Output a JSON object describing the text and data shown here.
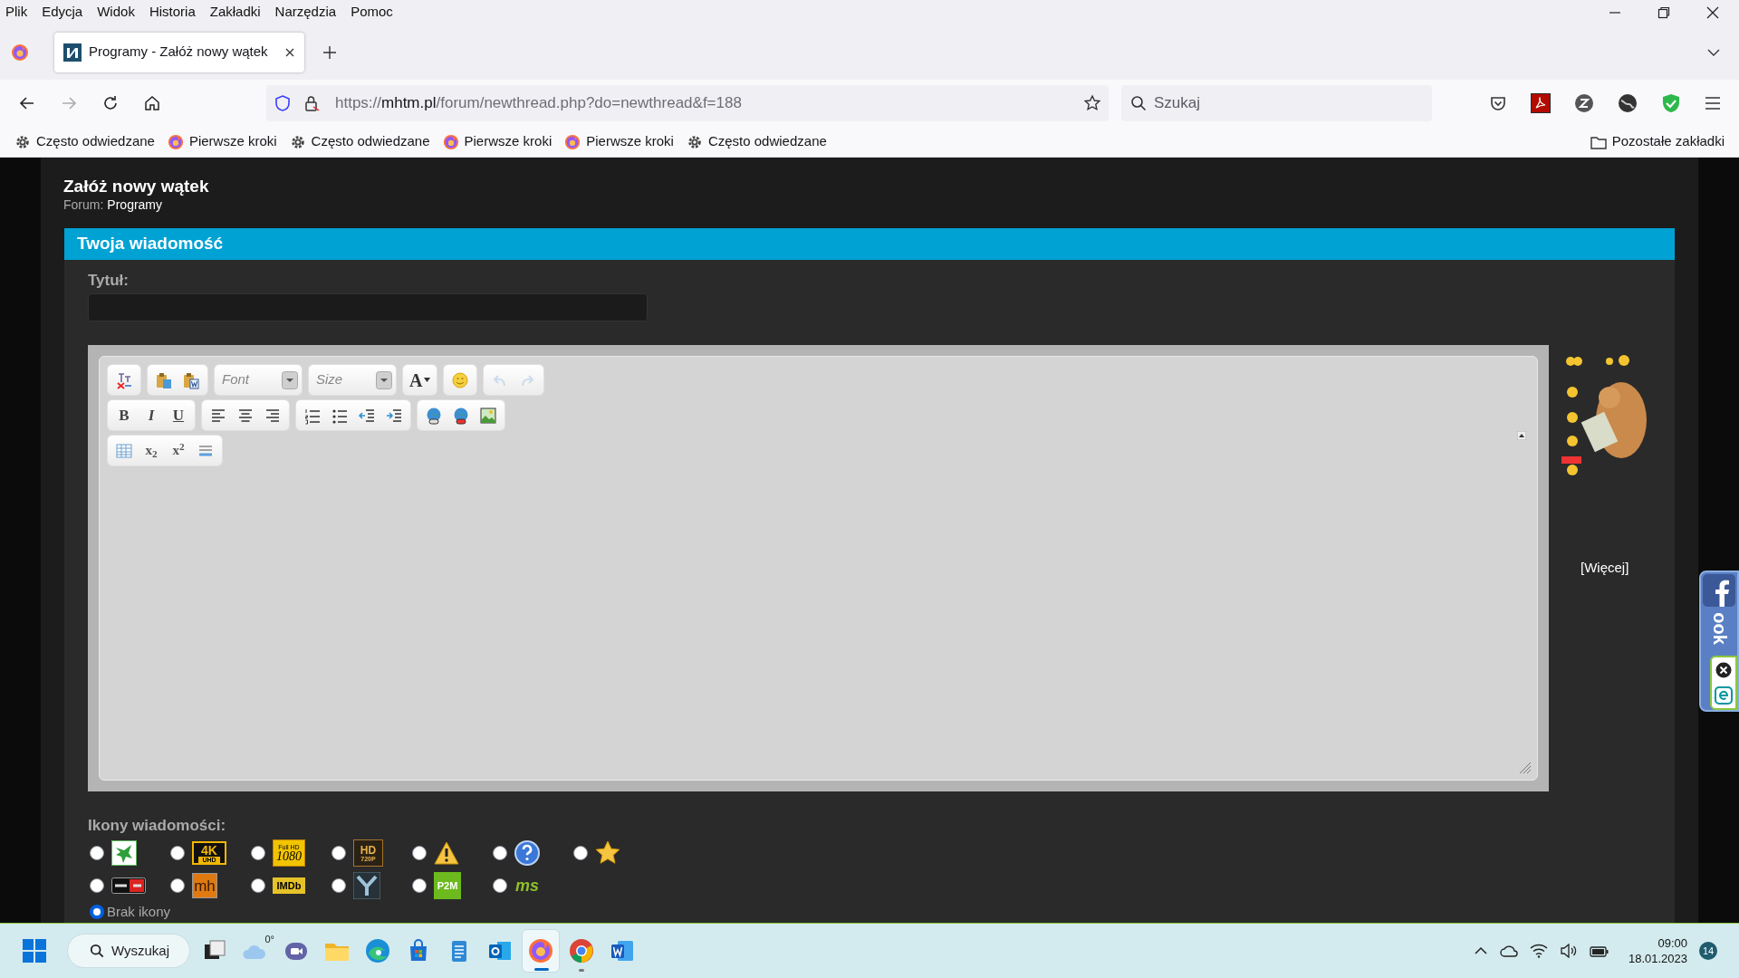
{
  "menu": [
    "Plik",
    "Edycja",
    "Widok",
    "Historia",
    "Zakładki",
    "Narzędzia",
    "Pomoc"
  ],
  "tab": {
    "title": "Programy - Załóż nowy wątek",
    "selected": true
  },
  "address_bar": {
    "url_scheme": "https://",
    "url_host": "mhtm.pl",
    "url_path": "/forum/newthread.php?do=newthread&f=188"
  },
  "search_field": {
    "placeholder": "Szukaj"
  },
  "bookmarks": [
    {
      "kind": "gear",
      "label": "Często odwiedzane"
    },
    {
      "kind": "firefox",
      "label": "Pierwsze kroki"
    },
    {
      "kind": "gear",
      "label": "Często odwiedzane"
    },
    {
      "kind": "firefox",
      "label": "Pierwsze kroki"
    },
    {
      "kind": "firefox",
      "label": "Pierwsze kroki"
    },
    {
      "kind": "gear",
      "label": "Często odwiedzane"
    }
  ],
  "other_bookmarks": "Pozostałe zakładki",
  "page": {
    "title": "Załóż nowy wątek",
    "forum_label": "Forum:",
    "forum_link": "Programy",
    "section_title": "Twoja wiadomość",
    "title_field": {
      "label": "Tytuł:"
    },
    "editor": {
      "toolbar": [
        [
          [
            {
              "kind": "remove-format",
              "disabled": false
            }
          ],
          [
            {
              "kind": "paste",
              "disabled": false
            },
            {
              "kind": "paste-word",
              "disabled": false
            }
          ],
          [
            {
              "kind": "select",
              "placeholder": "Font",
              "disabled": false
            }
          ],
          [
            {
              "kind": "select",
              "placeholder": "Size",
              "disabled": false
            }
          ],
          [
            {
              "kind": "font-color",
              "label": "A",
              "disabled": false
            }
          ],
          [
            {
              "kind": "smiley",
              "disabled": false
            }
          ],
          [
            {
              "kind": "undo",
              "disabled": true
            },
            {
              "kind": "redo",
              "disabled": true
            }
          ]
        ],
        [
          [
            {
              "kind": "bold",
              "label": "B",
              "disabled": false
            },
            {
              "kind": "italic",
              "label": "I",
              "disabled": false
            },
            {
              "kind": "underline",
              "label": "U",
              "disabled": false
            }
          ],
          [
            {
              "kind": "align-left",
              "disabled": false
            },
            {
              "kind": "align-center",
              "disabled": false
            },
            {
              "kind": "align-right",
              "disabled": false
            }
          ],
          [
            {
              "kind": "ordered-list",
              "disabled": false
            },
            {
              "kind": "bullet-list",
              "disabled": false
            },
            {
              "kind": "outdent",
              "disabled": false
            },
            {
              "kind": "indent",
              "disabled": false
            }
          ],
          [
            {
              "kind": "link",
              "disabled": false
            },
            {
              "kind": "unlink",
              "disabled": false
            },
            {
              "kind": "image",
              "disabled": false
            }
          ]
        ],
        [
          [
            {
              "kind": "table",
              "disabled": false
            },
            {
              "kind": "subscript",
              "label": "x$_{2}$",
              "disabled": false
            },
            {
              "kind": "superscript",
              "label": "x$^{2}$",
              "disabled": false
            },
            {
              "kind": "horizontal-rule",
              "disabled": false
            }
          ]
        ]
      ]
    },
    "smilies_more": "[Więcej]",
    "message_icons": {
      "label": "Ikony wiadomości:",
      "rows": [
        [
          {
            "kind": "leaf",
            "selected": false
          },
          {
            "kind": "uhd",
            "lines": [
              "4K",
              "UHD"
            ],
            "selected": false
          },
          {
            "kind": "fullhd",
            "lines": [
              "Full HD",
              "1080"
            ],
            "selected": false
          },
          {
            "kind": "hd",
            "lines": [
              "HD",
              "720P"
            ],
            "selected": false
          },
          {
            "kind": "warning",
            "selected": false
          },
          {
            "kind": "question",
            "selected": false
          },
          {
            "kind": "star",
            "selected": false
          }
        ],
        [
          {
            "kind": "banner",
            "selected": false
          },
          {
            "kind": "mh",
            "lines": [
              "mh"
            ],
            "selected": false
          },
          {
            "kind": "imdb",
            "lines": [
              "IMDb"
            ],
            "selected": false
          },
          {
            "kind": "y",
            "selected": false
          },
          {
            "kind": "p2m",
            "lines": [
              "P2M"
            ],
            "selected": false
          },
          {
            "kind": "ms",
            "lines": [
              "ms"
            ],
            "selected": false
          }
        ]
      ],
      "none": {
        "label": "Brak ikony",
        "selected": true
      }
    }
  },
  "facebook_tab": {
    "text": "ook"
  },
  "taskbar": {
    "search": "Wyszukaj",
    "weather": "0°",
    "apps": [
      {
        "kind": "task-view",
        "selected": false,
        "running": false
      },
      {
        "kind": "weather",
        "selected": false,
        "running": false
      },
      {
        "kind": "chat",
        "selected": false,
        "running": false
      },
      {
        "kind": "folder",
        "selected": false,
        "running": false
      },
      {
        "kind": "edge",
        "selected": false,
        "running": false
      },
      {
        "kind": "store",
        "selected": false,
        "running": false
      },
      {
        "kind": "notepad",
        "selected": false,
        "running": false
      },
      {
        "kind": "outlook",
        "selected": false,
        "running": false
      },
      {
        "kind": "firefox",
        "selected": true,
        "running": true
      },
      {
        "kind": "chrome",
        "selected": false,
        "running": true
      },
      {
        "kind": "word",
        "selected": false,
        "running": false
      }
    ],
    "time": "09:00",
    "date": "18.01.2023",
    "notifications": "14"
  }
}
